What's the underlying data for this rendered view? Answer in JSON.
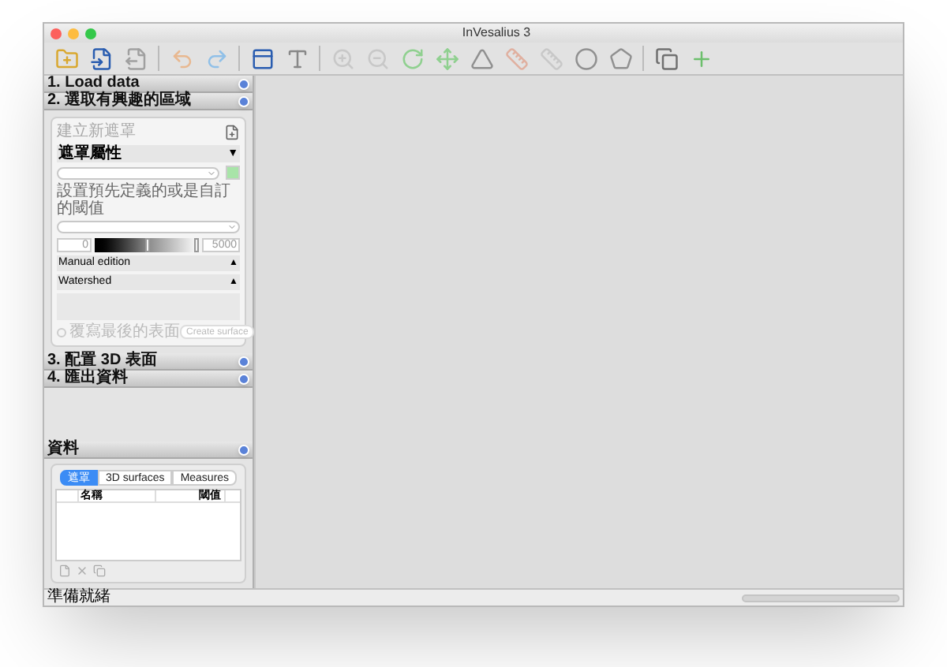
{
  "window": {
    "title": "InVesalius 3"
  },
  "sections_top": [
    {
      "label": "1. Load data"
    },
    {
      "label": "2. 選取有興趣的區域"
    }
  ],
  "mask_panel": {
    "new_mask": "建立新遮罩",
    "properties_header": "遮罩屬性",
    "properties_toggle": "▼",
    "threshold_label": "設置預先定義的或是自訂的閾值",
    "threshold_min": "0",
    "threshold_max": "5000",
    "thumbs": [
      {
        "level": 0.5
      },
      {
        "level": 1.0
      }
    ],
    "collapsibles": [
      {
        "label": "Manual edition",
        "toggle": "▲"
      },
      {
        "label": "Watershed",
        "toggle": "▲"
      }
    ],
    "overwrite": {
      "label": "覆寫最後的表面",
      "checked": false,
      "disabled": true
    },
    "create_button": {
      "label": "Create surface",
      "disabled": true
    }
  },
  "sections_bottom": [
    {
      "label": "3. 配置 3D 表面"
    },
    {
      "label": "4. 匯出資料"
    }
  ],
  "data_panel": {
    "header": "資料",
    "tabs": [
      {
        "label": "遮罩",
        "selected": true
      },
      {
        "label": "3D surfaces",
        "selected": false
      },
      {
        "label": "Measures",
        "selected": false
      }
    ],
    "columns": [
      "名稱",
      "閾值"
    ]
  },
  "status_bar": "準備就緒"
}
